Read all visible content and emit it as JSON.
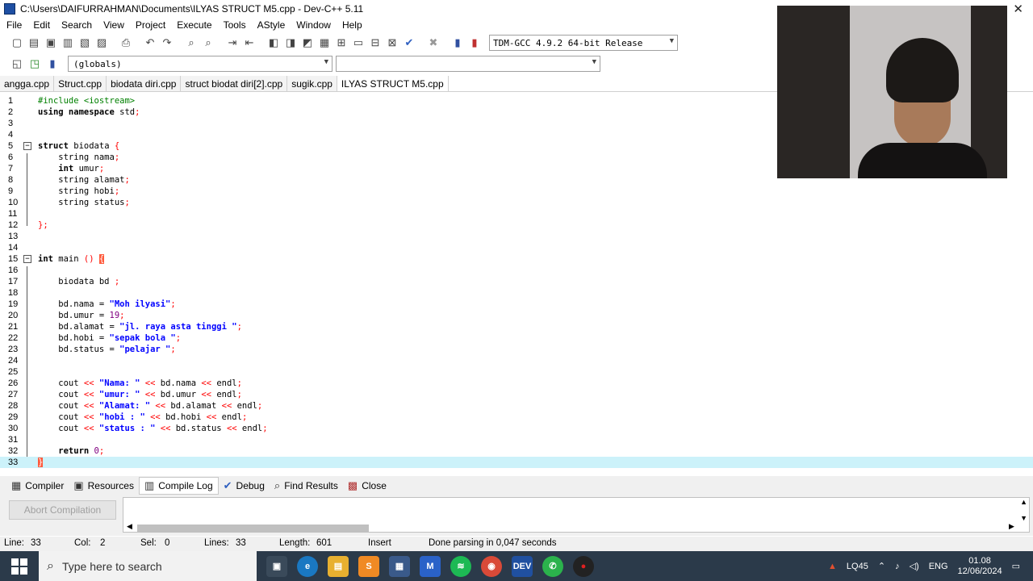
{
  "window": {
    "title": "C:\\Users\\DAIFURRAHMAN\\Documents\\ILYAS STRUCT M5.cpp - Dev-C++ 5.11",
    "close": "✕"
  },
  "menu": [
    "File",
    "Edit",
    "Search",
    "View",
    "Project",
    "Execute",
    "Tools",
    "AStyle",
    "Window",
    "Help"
  ],
  "toolbar": {
    "compiler": "TDM-GCC 4.9.2 64-bit Release",
    "scope": "(globals)",
    "symbol": ""
  },
  "tabs": [
    "angga.cpp",
    "Struct.cpp",
    "biodata diri.cpp",
    "struct biodat diri[2].cpp",
    "sugik.cpp",
    "ILYAS STRUCT M5.cpp"
  ],
  "editor": {
    "line_numbers": [
      "1",
      "2",
      "3",
      "4",
      "5",
      "6",
      "7",
      "8",
      "9",
      "10",
      "11",
      "12",
      "13",
      "14",
      "15",
      "16",
      "17",
      "18",
      "19",
      "20",
      "21",
      "22",
      "23",
      "24",
      "25",
      "26",
      "27",
      "28",
      "29",
      "30",
      "31",
      "32",
      "33"
    ],
    "l1_pp": "#include <iostream>",
    "l2_kw": "using namespace",
    "l2_id": " std",
    "l2_sym": ";",
    "l5_kw": "struct",
    "l5_id": " biodata ",
    "l5_sym": "{",
    "l6_id": "    string nama",
    "l6_sym": ";",
    "l7_kw": "    int",
    "l7_id": " umur",
    "l7_sym": ";",
    "l8_id": "    string alamat",
    "l8_sym": ";",
    "l9_id": "    string hobi",
    "l9_sym": ";",
    "l10_id": "    string status",
    "l10_sym": ";",
    "l12_sym": "};",
    "l15_kw": "int",
    "l15_id": " main ",
    "l15_sym": "() ",
    "l15_brace": "{",
    "l17_id": "    biodata bd ",
    "l17_sym": ";",
    "l19_id": "    bd.nama = ",
    "l19_str": "\"Moh ilyasi\"",
    "l19_sym": ";",
    "l20_id": "    bd.umur = ",
    "l20_num": "19",
    "l20_sym": ";",
    "l21_id": "    bd.alamat = ",
    "l21_str": "\"jl. raya asta tinggi \"",
    "l21_sym": ";",
    "l22_id": "    bd.hobi = ",
    "l22_str": "\"sepak bola \"",
    "l22_sym": ";",
    "l23_id": "    bd.status = ",
    "l23_str": "\"pelajar \"",
    "l23_sym": ";",
    "l26_a": "    cout ",
    "l26_b": "<<",
    "l26_str": " \"Nama: \" ",
    "l26_c": "<<",
    "l26_d": " bd.nama ",
    "l26_e": "<<",
    "l26_f": " endl",
    "l26_g": ";",
    "l27_a": "    cout ",
    "l27_b": "<<",
    "l27_str": " \"umur: \" ",
    "l27_c": "<<",
    "l27_d": " bd.umur ",
    "l27_e": "<<",
    "l27_f": " endl",
    "l27_g": ";",
    "l28_a": "    cout ",
    "l28_b": "<<",
    "l28_str": " \"Alamat: \" ",
    "l28_c": "<<",
    "l28_d": " bd.alamat ",
    "l28_e": "<<",
    "l28_f": " endl",
    "l28_g": ";",
    "l29_a": "    cout ",
    "l29_b": "<<",
    "l29_str": " \"hobi : \" ",
    "l29_c": "<<",
    "l29_d": " bd.hobi ",
    "l29_e": "<<",
    "l29_f": " endl",
    "l29_g": ";",
    "l30_a": "    cout ",
    "l30_b": "<<",
    "l30_str": " \"status : \" ",
    "l30_c": "<<",
    "l30_d": " bd.status ",
    "l30_e": "<<",
    "l30_f": " endl",
    "l30_g": ";",
    "l32_kw": "    return",
    "l32_num": " 0",
    "l32_sym": ";",
    "l33_brace": "}"
  },
  "bottom_tabs": [
    "Compiler",
    "Resources",
    "Compile Log",
    "Debug",
    "Find Results",
    "Close"
  ],
  "panel": {
    "abort_label": "Abort Compilation"
  },
  "status": {
    "line": "Line:",
    "line_val": "33",
    "col": "Col:",
    "col_val": "2",
    "sel": "Sel:",
    "sel_val": "0",
    "lines": "Lines:",
    "lines_val": "33",
    "length": "Length:",
    "length_val": "601",
    "mode": "Insert",
    "message": "Done parsing in 0,047 seconds"
  },
  "taskbar": {
    "search_placeholder": "Type here to search",
    "tray_app": "LQ45",
    "lang": "ENG",
    "time": "01.08",
    "date": "12/06/2024"
  },
  "colors": {
    "keyword": "#000000",
    "string": "#0000ff",
    "number": "#800080",
    "symbol": "#ff0000",
    "preprocessor": "#008000",
    "current_line": "#ccf2fa"
  }
}
